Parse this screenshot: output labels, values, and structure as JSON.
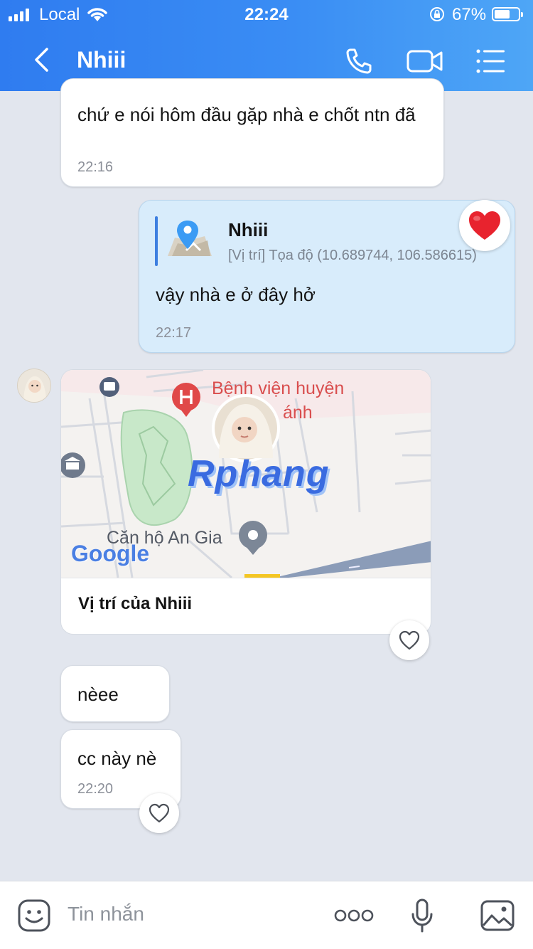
{
  "status_bar": {
    "carrier": "Local",
    "time": "22:24",
    "battery_percent": "67%",
    "battery_level": 0.67
  },
  "header": {
    "contact_name": "Nhiii"
  },
  "messages": {
    "m1": {
      "text": "chứ e nói hôm đầu gặp nhà e chốt ntn đã",
      "time": "22:16"
    },
    "m2": {
      "quote_name": "Nhiii",
      "quote_detail": "[Vị trí] Tọa độ (10.689744, 106.586615)",
      "text": "vậy nhà e ở đây hở",
      "time": "22:17",
      "reaction": "heart-filled-icon"
    },
    "map": {
      "label_hospital": "Bệnh viện huyện",
      "label_hospital_2": "ánh",
      "label_apartment": "Căn hộ An Gia",
      "watermark": "Rphang",
      "google": "Google",
      "footer": "Vị trí của Nhiii"
    },
    "m3": {
      "text": "nèee"
    },
    "m4": {
      "text": "cc này nè",
      "time": "22:20"
    }
  },
  "composer": {
    "placeholder": "Tin nhắn"
  },
  "colors": {
    "header": "#2f7cf0",
    "own_bubble": "#d8ecfb",
    "heart": "#e8232e"
  }
}
